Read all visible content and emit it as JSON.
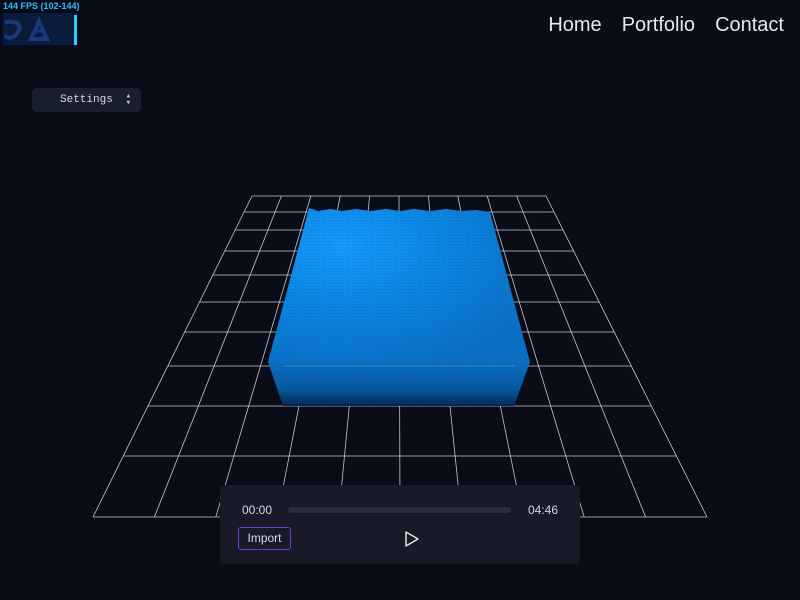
{
  "stats": {
    "fps_label": "144 FPS (102-144)",
    "accent_color": "#27d3f2"
  },
  "nav": {
    "items": [
      {
        "label": "Home"
      },
      {
        "label": "Portfolio"
      },
      {
        "label": "Contact"
      }
    ]
  },
  "settings": {
    "label": "Settings",
    "icon": "chevron-updown-icon"
  },
  "scene": {
    "grid": true,
    "block_color": "#0a86e0",
    "highlight_color": "#18a8ff"
  },
  "player": {
    "current_time": "00:00",
    "duration": "04:46",
    "progress": 0,
    "import_label": "Import",
    "play_icon": "play-icon",
    "accent_color": "#6a3bd6"
  }
}
